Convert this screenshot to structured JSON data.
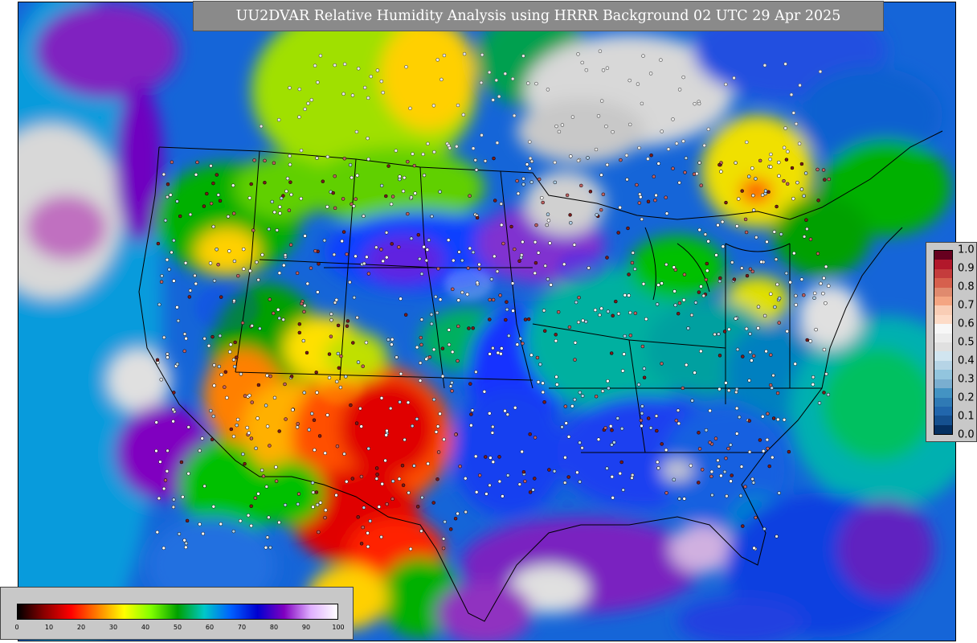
{
  "title": "UU2DVAR Relative Humidity Analysis using HRRR Background 02 UTC 29 Apr 2025",
  "map": {
    "projection": "lambert-conformal",
    "region": "CONUS",
    "background_fill_colors": {
      "ocean_moist": "#1f7fe0",
      "very_moist": "#6a1bb0",
      "saturated": "#d0d0d0",
      "moderate": "#00b000",
      "fairly_dry": "#ffd000",
      "very_dry": "#e00000",
      "mid": "#00c8c8"
    },
    "observation_markers": "circle-icon"
  },
  "rh_colorbar": {
    "ticks": [
      "0",
      "10",
      "20",
      "30",
      "40",
      "50",
      "60",
      "70",
      "80",
      "90",
      "100"
    ],
    "colors": [
      "#000000",
      "#8b0000",
      "#ff0000",
      "#ff8000",
      "#ffff00",
      "#80ff00",
      "#00a000",
      "#00c8c8",
      "#0060ff",
      "#0000d0",
      "#8000c0",
      "#e0b0ff",
      "#ffffff"
    ]
  },
  "increment_colorbar": {
    "ticks": [
      "1.0",
      "0.9",
      "0.8",
      "0.7",
      "0.6",
      "0.5",
      "0.4",
      "0.3",
      "0.2",
      "0.1",
      "0.0"
    ],
    "colors": [
      "#67001f",
      "#b2182b",
      "#c43c3c",
      "#d6604d",
      "#e08a6e",
      "#f4a582",
      "#f9cdb5",
      "#fddbc7",
      "#f7f7f7",
      "#ececec",
      "#e0e0e0",
      "#d1e5f0",
      "#b6d4e6",
      "#92c5de",
      "#7aaed0",
      "#4393c3",
      "#2f7ab5",
      "#2166ac",
      "#15508f",
      "#053061"
    ]
  }
}
